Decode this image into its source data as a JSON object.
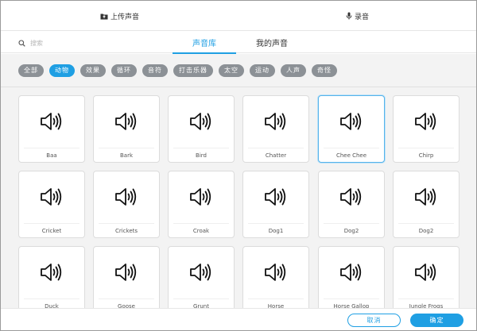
{
  "header": {
    "upload_label": "上传声音",
    "record_label": "录音"
  },
  "search": {
    "placeholder": "搜索"
  },
  "tabs": [
    {
      "label": "声音库",
      "active": true
    },
    {
      "label": "我的声音",
      "active": false
    }
  ],
  "filters": [
    {
      "label": "全部",
      "active": false
    },
    {
      "label": "动物",
      "active": true
    },
    {
      "label": "效果",
      "active": false
    },
    {
      "label": "循环",
      "active": false
    },
    {
      "label": "音符",
      "active": false
    },
    {
      "label": "打击乐器",
      "active": false
    },
    {
      "label": "太空",
      "active": false
    },
    {
      "label": "运动",
      "active": false
    },
    {
      "label": "人声",
      "active": false
    },
    {
      "label": "奇怪",
      "active": false
    }
  ],
  "sounds": [
    {
      "name": "Baa"
    },
    {
      "name": "Bark"
    },
    {
      "name": "Bird"
    },
    {
      "name": "Chatter"
    },
    {
      "name": "Chee Chee",
      "selected": true
    },
    {
      "name": "Chirp"
    },
    {
      "name": "Cricket"
    },
    {
      "name": "Crickets"
    },
    {
      "name": "Croak"
    },
    {
      "name": "Dog1"
    },
    {
      "name": "Dog2"
    },
    {
      "name": "Dog2"
    },
    {
      "name": "Duck"
    },
    {
      "name": "Goose"
    },
    {
      "name": "Grunt"
    },
    {
      "name": "Horse"
    },
    {
      "name": "Horse Gallop"
    },
    {
      "name": "Jungle Frogs"
    }
  ],
  "footer": {
    "cancel_label": "取消",
    "ok_label": "确定"
  },
  "colors": {
    "accent": "#1f9fe3",
    "chip": "#8c9196",
    "background": "#f3f3f3"
  },
  "icons": {
    "upload": "upload-icon",
    "record": "microphone-icon",
    "search": "search-icon",
    "sound": "speaker-icon"
  }
}
